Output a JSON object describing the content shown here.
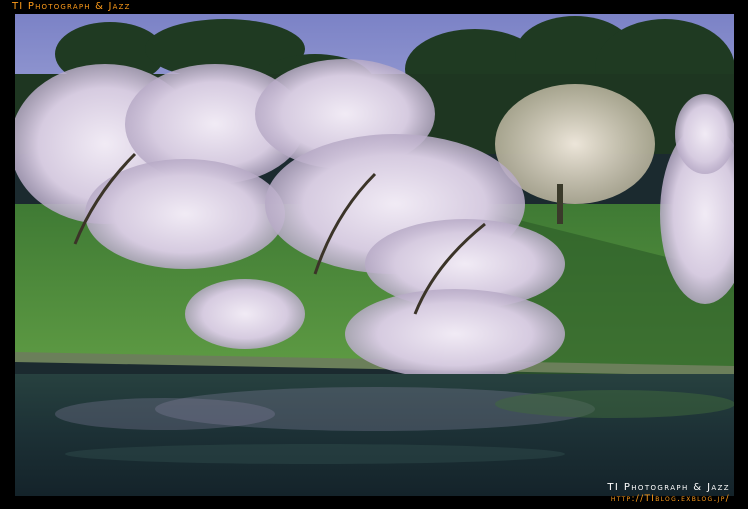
{
  "watermark": {
    "top_label": "TI Photograph & Jazz",
    "bottom_title": "TI Photograph & Jazz",
    "bottom_url": "http://TIblog.exblog.jp/"
  },
  "colors": {
    "frame": "#000000",
    "watermark_orange": "#ff9c1a",
    "watermark_white": "#ffffff",
    "sky": "#7f86c8",
    "blossom": "#e4dcec",
    "grass": "#4e8a3a",
    "water": "#1e3238"
  },
  "scene": {
    "subject": "cherry-blossom-trees-by-moat"
  }
}
